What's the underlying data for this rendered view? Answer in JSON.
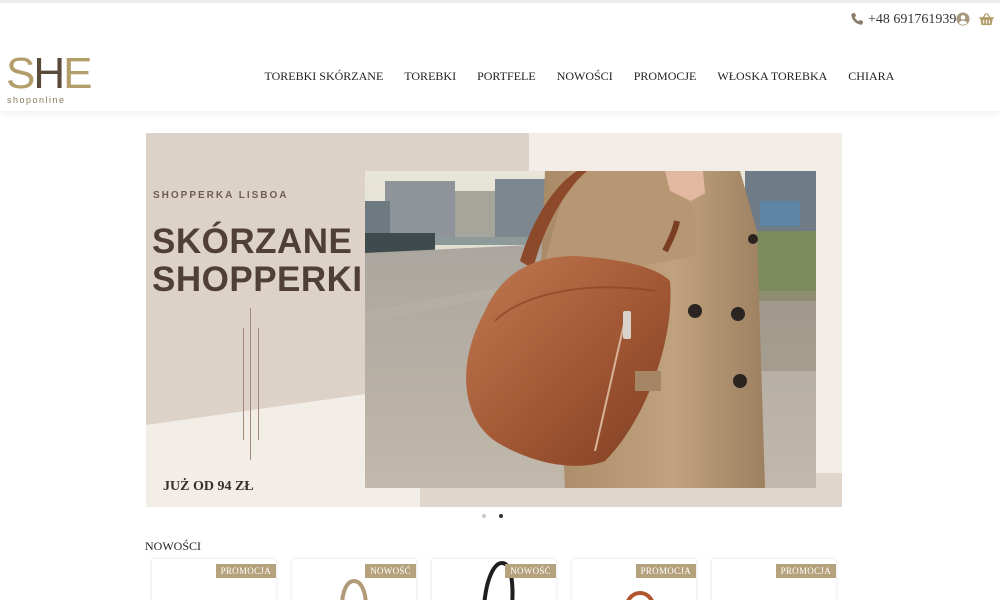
{
  "topbar": {
    "phone": "+48 691761939",
    "icons": [
      "phone-icon",
      "user-icon",
      "basket-icon"
    ]
  },
  "logo": {
    "mark_s": "S",
    "mark_h": "H",
    "mark_e": "E",
    "tagline": "shoponline"
  },
  "nav": {
    "items": [
      "TOREBKI SKÓRZANE",
      "TOREBKI",
      "PORTFELE",
      "NOWOŚCI",
      "PROMOCJE",
      "WŁOSKA TOREBKA",
      "CHIARA"
    ]
  },
  "hero": {
    "eyebrow": "SHOPPERKA LISBOA",
    "title_line1": "SKÓRZANE",
    "title_line2": "SHOPPERKI",
    "price": "JUŻ OD 94 ZŁ",
    "slides_total": 2,
    "active_slide": 2
  },
  "section": {
    "title": "NOWOŚCI"
  },
  "cards": [
    {
      "badge": "PROMOCJA"
    },
    {
      "badge": "NOWOŚĆ"
    },
    {
      "badge": "NOWOŚĆ"
    },
    {
      "badge": "PROMOCJA"
    },
    {
      "badge": "PROMOCJA"
    }
  ],
  "colors": {
    "accent_gold": "#b5a27d",
    "hero_text": "#4f3f34",
    "hero_bg": "#f1ece6"
  }
}
